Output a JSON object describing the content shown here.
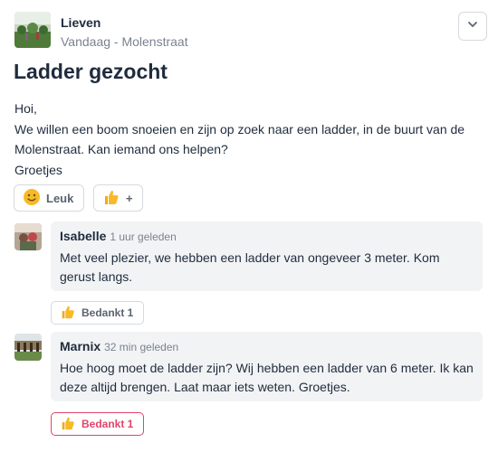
{
  "post": {
    "author": "Lieven",
    "meta": "Vandaag - Molenstraat",
    "title": "Ladder gezocht",
    "body": [
      "Hoi,",
      "We willen een boom snoeien en zijn op zoek naar een ladder, in de buurt van de Molenstraat. Kan iemand ons helpen?",
      "Groetjes"
    ],
    "like_label": "Leuk",
    "thanks_label": "+"
  },
  "comments": [
    {
      "author": "Isabelle",
      "time": "1 uur geleden",
      "text": "Met veel plezier, we hebben een ladder van ongeveer 3 meter. Kom gerust langs.",
      "thanks_label": "Bedankt 1",
      "thanked": false
    },
    {
      "author": "Marnix",
      "time": "32 min geleden",
      "text": "Hoe hoog moet de ladder zijn? Wij hebben een ladder van 6 meter. Ik kan deze altijd brengen. Laat maar iets weten. Groetjes.",
      "thanks_label": "Bedankt 1",
      "thanked": true
    }
  ],
  "colors": {
    "accent": "#e0446a",
    "emoji": "#f7b928"
  },
  "icons": {
    "menu": "chevron-down-icon",
    "like": "smiley-icon",
    "thanks": "thumbs-up-icon"
  }
}
